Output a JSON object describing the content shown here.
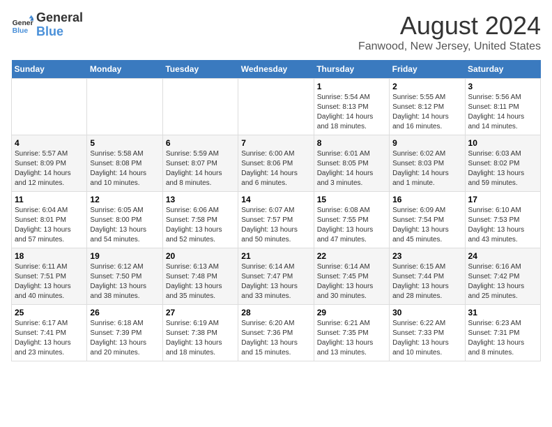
{
  "header": {
    "logo_line1": "General",
    "logo_line2": "Blue",
    "title": "August 2024",
    "subtitle": "Fanwood, New Jersey, United States"
  },
  "weekdays": [
    "Sunday",
    "Monday",
    "Tuesday",
    "Wednesday",
    "Thursday",
    "Friday",
    "Saturday"
  ],
  "weeks": [
    [
      {
        "day": "",
        "content": ""
      },
      {
        "day": "",
        "content": ""
      },
      {
        "day": "",
        "content": ""
      },
      {
        "day": "",
        "content": ""
      },
      {
        "day": "1",
        "content": "Sunrise: 5:54 AM\nSunset: 8:13 PM\nDaylight: 14 hours\nand 18 minutes."
      },
      {
        "day": "2",
        "content": "Sunrise: 5:55 AM\nSunset: 8:12 PM\nDaylight: 14 hours\nand 16 minutes."
      },
      {
        "day": "3",
        "content": "Sunrise: 5:56 AM\nSunset: 8:11 PM\nDaylight: 14 hours\nand 14 minutes."
      }
    ],
    [
      {
        "day": "4",
        "content": "Sunrise: 5:57 AM\nSunset: 8:09 PM\nDaylight: 14 hours\nand 12 minutes."
      },
      {
        "day": "5",
        "content": "Sunrise: 5:58 AM\nSunset: 8:08 PM\nDaylight: 14 hours\nand 10 minutes."
      },
      {
        "day": "6",
        "content": "Sunrise: 5:59 AM\nSunset: 8:07 PM\nDaylight: 14 hours\nand 8 minutes."
      },
      {
        "day": "7",
        "content": "Sunrise: 6:00 AM\nSunset: 8:06 PM\nDaylight: 14 hours\nand 6 minutes."
      },
      {
        "day": "8",
        "content": "Sunrise: 6:01 AM\nSunset: 8:05 PM\nDaylight: 14 hours\nand 3 minutes."
      },
      {
        "day": "9",
        "content": "Sunrise: 6:02 AM\nSunset: 8:03 PM\nDaylight: 14 hours\nand 1 minute."
      },
      {
        "day": "10",
        "content": "Sunrise: 6:03 AM\nSunset: 8:02 PM\nDaylight: 13 hours\nand 59 minutes."
      }
    ],
    [
      {
        "day": "11",
        "content": "Sunrise: 6:04 AM\nSunset: 8:01 PM\nDaylight: 13 hours\nand 57 minutes."
      },
      {
        "day": "12",
        "content": "Sunrise: 6:05 AM\nSunset: 8:00 PM\nDaylight: 13 hours\nand 54 minutes."
      },
      {
        "day": "13",
        "content": "Sunrise: 6:06 AM\nSunset: 7:58 PM\nDaylight: 13 hours\nand 52 minutes."
      },
      {
        "day": "14",
        "content": "Sunrise: 6:07 AM\nSunset: 7:57 PM\nDaylight: 13 hours\nand 50 minutes."
      },
      {
        "day": "15",
        "content": "Sunrise: 6:08 AM\nSunset: 7:55 PM\nDaylight: 13 hours\nand 47 minutes."
      },
      {
        "day": "16",
        "content": "Sunrise: 6:09 AM\nSunset: 7:54 PM\nDaylight: 13 hours\nand 45 minutes."
      },
      {
        "day": "17",
        "content": "Sunrise: 6:10 AM\nSunset: 7:53 PM\nDaylight: 13 hours\nand 43 minutes."
      }
    ],
    [
      {
        "day": "18",
        "content": "Sunrise: 6:11 AM\nSunset: 7:51 PM\nDaylight: 13 hours\nand 40 minutes."
      },
      {
        "day": "19",
        "content": "Sunrise: 6:12 AM\nSunset: 7:50 PM\nDaylight: 13 hours\nand 38 minutes."
      },
      {
        "day": "20",
        "content": "Sunrise: 6:13 AM\nSunset: 7:48 PM\nDaylight: 13 hours\nand 35 minutes."
      },
      {
        "day": "21",
        "content": "Sunrise: 6:14 AM\nSunset: 7:47 PM\nDaylight: 13 hours\nand 33 minutes."
      },
      {
        "day": "22",
        "content": "Sunrise: 6:14 AM\nSunset: 7:45 PM\nDaylight: 13 hours\nand 30 minutes."
      },
      {
        "day": "23",
        "content": "Sunrise: 6:15 AM\nSunset: 7:44 PM\nDaylight: 13 hours\nand 28 minutes."
      },
      {
        "day": "24",
        "content": "Sunrise: 6:16 AM\nSunset: 7:42 PM\nDaylight: 13 hours\nand 25 minutes."
      }
    ],
    [
      {
        "day": "25",
        "content": "Sunrise: 6:17 AM\nSunset: 7:41 PM\nDaylight: 13 hours\nand 23 minutes."
      },
      {
        "day": "26",
        "content": "Sunrise: 6:18 AM\nSunset: 7:39 PM\nDaylight: 13 hours\nand 20 minutes."
      },
      {
        "day": "27",
        "content": "Sunrise: 6:19 AM\nSunset: 7:38 PM\nDaylight: 13 hours\nand 18 minutes."
      },
      {
        "day": "28",
        "content": "Sunrise: 6:20 AM\nSunset: 7:36 PM\nDaylight: 13 hours\nand 15 minutes."
      },
      {
        "day": "29",
        "content": "Sunrise: 6:21 AM\nSunset: 7:35 PM\nDaylight: 13 hours\nand 13 minutes."
      },
      {
        "day": "30",
        "content": "Sunrise: 6:22 AM\nSunset: 7:33 PM\nDaylight: 13 hours\nand 10 minutes."
      },
      {
        "day": "31",
        "content": "Sunrise: 6:23 AM\nSunset: 7:31 PM\nDaylight: 13 hours\nand 8 minutes."
      }
    ]
  ]
}
